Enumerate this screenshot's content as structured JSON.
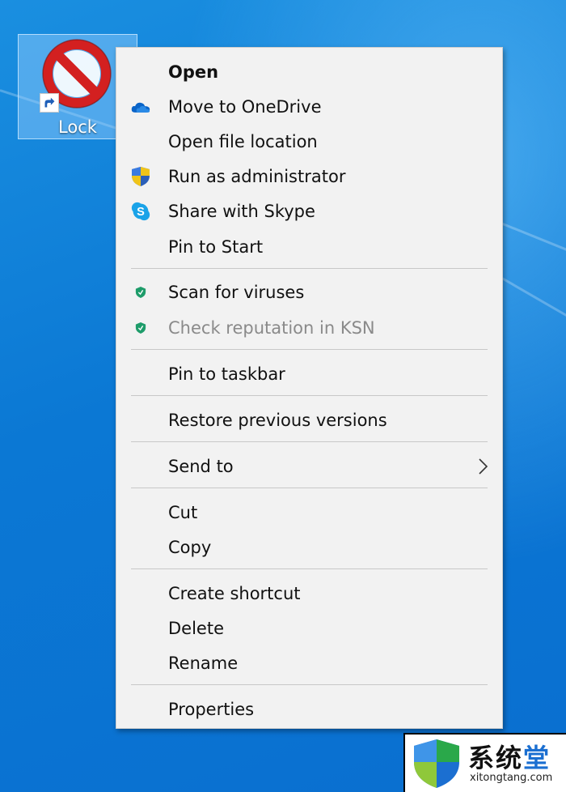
{
  "desktop": {
    "icon_label": "Lock"
  },
  "menu": {
    "items": [
      {
        "label": "Open",
        "icon": "none",
        "style": "bold"
      },
      {
        "label": "Move to OneDrive",
        "icon": "onedrive-icon"
      },
      {
        "label": "Open file location",
        "icon": "none"
      },
      {
        "label": "Run as administrator",
        "icon": "uac-shield-icon"
      },
      {
        "label": "Share with Skype",
        "icon": "skype-icon"
      },
      {
        "label": "Pin to Start",
        "icon": "none"
      },
      {
        "label": "Scan for viruses",
        "icon": "kaspersky-shield-icon"
      },
      {
        "label": "Check reputation in KSN",
        "icon": "kaspersky-shield-icon",
        "state": "disabled"
      },
      {
        "label": "Pin to taskbar",
        "icon": "none"
      },
      {
        "label": "Restore previous versions",
        "icon": "none"
      },
      {
        "label": "Send to",
        "icon": "none",
        "submenu": true
      },
      {
        "label": "Cut",
        "icon": "none"
      },
      {
        "label": "Copy",
        "icon": "none"
      },
      {
        "label": "Create shortcut",
        "icon": "none"
      },
      {
        "label": "Delete",
        "icon": "none"
      },
      {
        "label": "Rename",
        "icon": "none"
      },
      {
        "label": "Properties",
        "icon": "none"
      }
    ]
  },
  "watermark": {
    "chinese_text": "系统",
    "chinese_accent": "堂",
    "url": "xitongtang.com"
  },
  "colors": {
    "desktop_blue": "#0b78d4",
    "menu_bg": "#f2f2f2",
    "kaspersky_green": "#1e9c6a",
    "onedrive_blue": "#0a64c8",
    "skype_blue": "#1aa3e8"
  }
}
